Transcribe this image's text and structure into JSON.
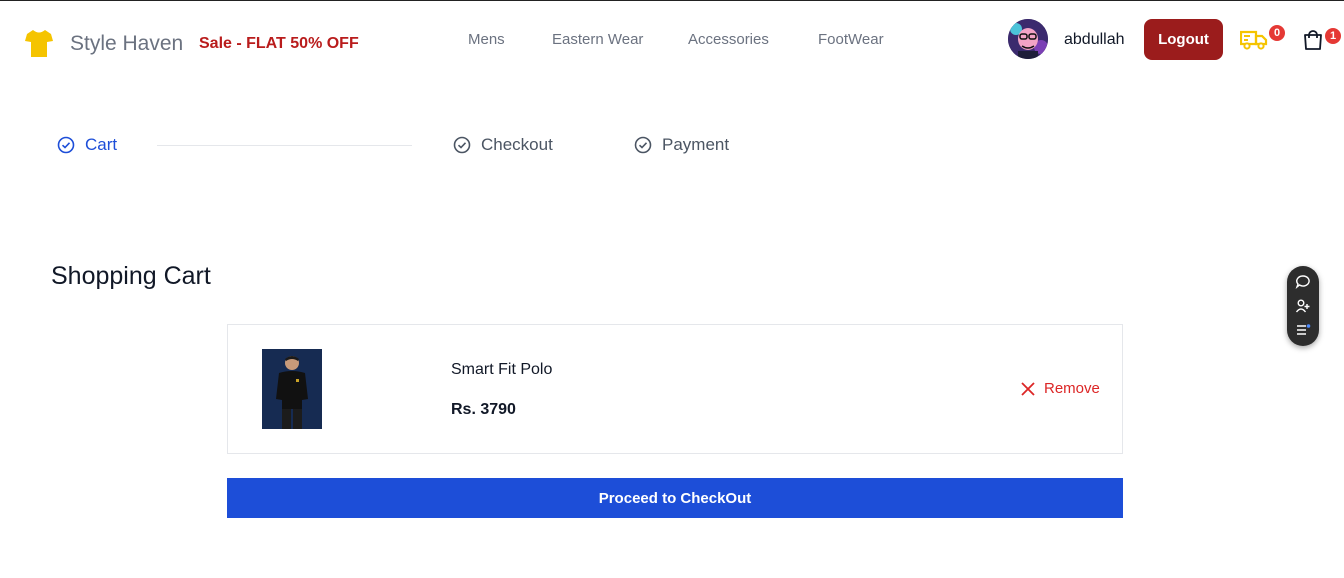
{
  "header": {
    "brand": "Style Haven",
    "sale": "Sale - FLAT 50% OFF",
    "nav": [
      "Mens",
      "Eastern Wear",
      "Accessories",
      "FootWear"
    ],
    "username": "abdullah",
    "logout_label": "Logout",
    "truck_count": "0",
    "cart_count": "1",
    "logo_icon": "tshirt-icon",
    "brand_color": "#f5c400"
  },
  "steps": {
    "items": [
      "Cart",
      "Checkout",
      "Payment"
    ],
    "active": "Cart",
    "active_color": "#1d4ed8"
  },
  "cart": {
    "title": "Shopping Cart",
    "items": [
      {
        "name": "Smart Fit Polo",
        "price": "Rs. 3790"
      }
    ],
    "remove_label": "Remove",
    "proceed_label": "Proceed to CheckOut"
  },
  "colors": {
    "sale": "#b91c1c",
    "logout_bg": "#9b1c1c",
    "primary": "#1d4ed8",
    "remove": "#dc2626",
    "badge": "#e53935"
  }
}
